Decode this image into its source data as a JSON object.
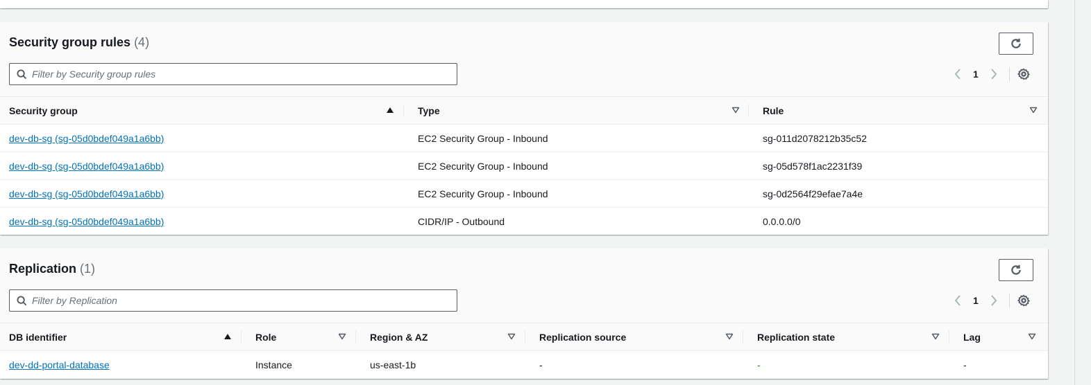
{
  "security_group_rules": {
    "title": "Security group rules",
    "count": "(4)",
    "filter_placeholder": "Filter by Security group rules",
    "page": "1",
    "columns": [
      "Security group",
      "Type",
      "Rule"
    ],
    "rows": [
      {
        "security_group": "dev-db-sg (sg-05d0bdef049a1a6bb)",
        "type": "EC2 Security Group - Inbound",
        "rule": "sg-011d2078212b35c52"
      },
      {
        "security_group": "dev-db-sg (sg-05d0bdef049a1a6bb)",
        "type": "EC2 Security Group - Inbound",
        "rule": "sg-05d578f1ac2231f39"
      },
      {
        "security_group": "dev-db-sg (sg-05d0bdef049a1a6bb)",
        "type": "EC2 Security Group - Inbound",
        "rule": "sg-0d2564f29efae7a4e"
      },
      {
        "security_group": "dev-db-sg (sg-05d0bdef049a1a6bb)",
        "type": "CIDR/IP - Outbound",
        "rule": "0.0.0.0/0"
      }
    ]
  },
  "replication": {
    "title": "Replication",
    "count": "(1)",
    "filter_placeholder": "Filter by Replication",
    "page": "1",
    "columns": [
      "DB identifier",
      "Role",
      "Region & AZ",
      "Replication source",
      "Replication state",
      "Lag"
    ],
    "rows": [
      {
        "db_identifier": "dev-dd-portal-database",
        "role": "Instance",
        "region_az": "us-east-1b",
        "replication_source": "-",
        "replication_state": "-",
        "lag": "-"
      }
    ]
  },
  "icons": {
    "refresh": "refresh-icon",
    "search": "search-icon",
    "prev": "chevron-left-icon",
    "next": "chevron-right-icon",
    "settings": "gear-icon",
    "sort_asc": "sort-ascending-icon",
    "sort_none": "sort-descending-outline-icon"
  },
  "colors": {
    "link": "#0073bb",
    "text": "#16191f",
    "muted": "#687078",
    "success": "#1d8102",
    "page_bg": "#f2f3f3"
  }
}
